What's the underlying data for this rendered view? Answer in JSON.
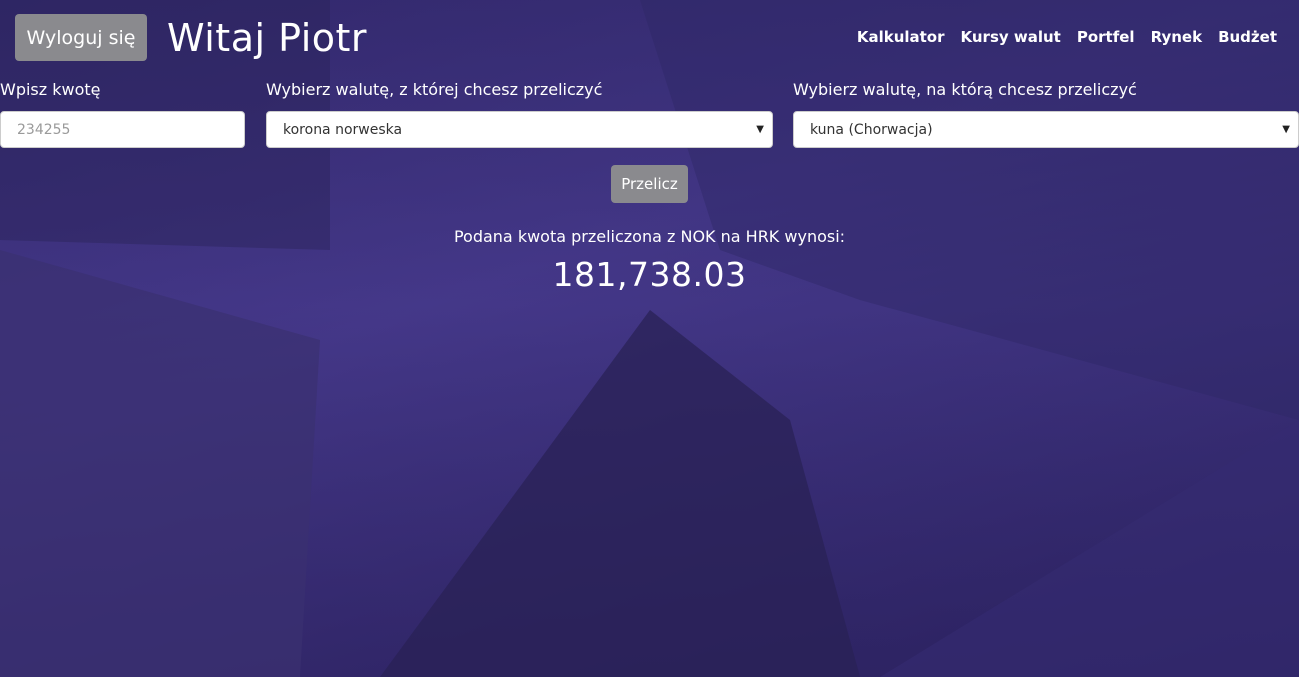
{
  "header": {
    "logout_label": "Wyloguj się",
    "greeting": "Witaj Piotr"
  },
  "nav": {
    "items": [
      "Kalkulator",
      "Kursy walut",
      "Portfel",
      "Rynek",
      "Budżet"
    ]
  },
  "form": {
    "amount_label": "Wpisz kwotę",
    "amount_placeholder": "234255",
    "from_label": "Wybierz walutę, z której chcesz przeliczyć",
    "from_selected": "korona norweska",
    "to_label": "Wybierz walutę, na którą chcesz przeliczyć",
    "to_selected": "kuna (Chorwacja)",
    "convert_label": "Przelicz"
  },
  "result": {
    "label": "Podana kwota przeliczona z NOK na HRK wynosi:",
    "value": "181,738.03"
  },
  "colors": {
    "overlay": "#2c2463",
    "button": "#8a8a8e",
    "text": "#ffffff"
  }
}
